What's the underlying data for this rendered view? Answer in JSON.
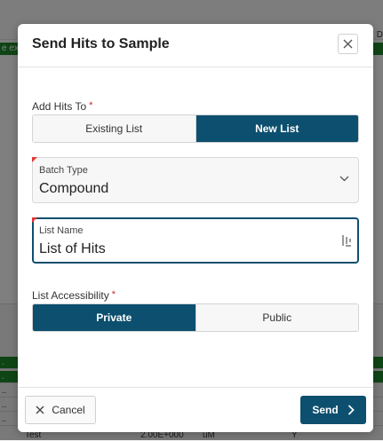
{
  "background": {
    "strip_text": "e exe",
    "corner_text": "D",
    "rows": [
      ".",
      ".",
      "..",
      "..",
      ".."
    ],
    "last_row": [
      "Test",
      "2.00E+000",
      "uM",
      "Y"
    ]
  },
  "modal": {
    "title": "Send Hits to Sample",
    "close_icon": "close-icon",
    "add_hits_to": {
      "label": "Add Hits To",
      "required_mark": "*",
      "options": [
        "Existing List",
        "New List"
      ],
      "selected": "New List"
    },
    "batch_type": {
      "label": "Batch Type",
      "value": "Compound"
    },
    "list_name": {
      "label": "List Name",
      "value": "List of Hits"
    },
    "list_accessibility": {
      "label": "List Accessibility",
      "required_mark": "*",
      "options": [
        "Private",
        "Public"
      ],
      "selected": "Private"
    },
    "footer": {
      "cancel_label": "Cancel",
      "send_label": "Send"
    }
  },
  "colors": {
    "primary": "#0d4f6e",
    "required": "#e53935",
    "background_green": "#1f8a2b"
  }
}
